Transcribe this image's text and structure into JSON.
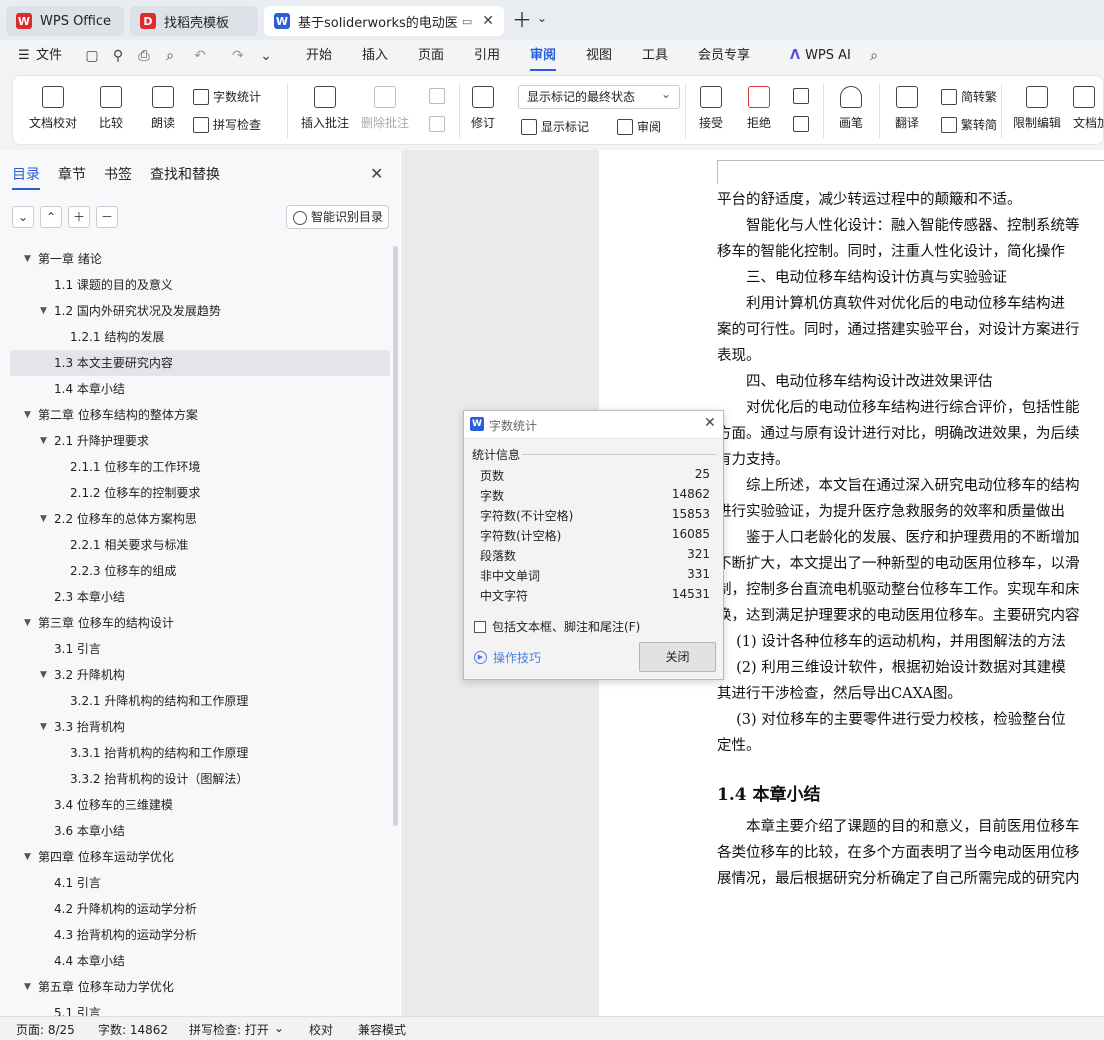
{
  "tabs": [
    {
      "label": "WPS Office",
      "logo": "W",
      "color": "#e02a2a"
    },
    {
      "label": "找稻壳模板",
      "logo": "D",
      "color": "#e02a2a"
    },
    {
      "label": "基于soliderworks的电动医用",
      "logo": "W",
      "color": "#2b5fd9"
    }
  ],
  "menu": {
    "file": "文件",
    "items": [
      "开始",
      "插入",
      "页面",
      "引用",
      "审阅",
      "视图",
      "工具",
      "会员专享"
    ],
    "active": "审阅",
    "wps_ai": "WPS AI"
  },
  "ribbon": {
    "doc_check": "文档校对",
    "compare": "比较",
    "read_aloud": "朗读",
    "word_count": "字数统计",
    "spell_check": "拼写检查",
    "insert_comment": "插入批注",
    "delete_comment": "删除批注",
    "revise": "修订",
    "markup_select": "显示标记的最终状态",
    "show_markup": "显示标记",
    "review_pane": "审阅",
    "accept": "接受",
    "reject": "拒绝",
    "pen": "画笔",
    "translate": "翻译",
    "to_traditional": "简转繁",
    "to_simplified": "繁转简",
    "restrict_edit": "限制编辑",
    "doc_protect": "文档加"
  },
  "nav": {
    "tabs": [
      "目录",
      "章节",
      "书签",
      "查找和替换"
    ],
    "smart_toc": "智能识别目录",
    "toc": [
      {
        "label": "第一章  绪论",
        "level": 0,
        "exp": true
      },
      {
        "label": "1.1  课题的目的及意义",
        "level": 1
      },
      {
        "label": "1.2  国内外研究状况及发展趋势",
        "level": 1,
        "exp": true
      },
      {
        "label": "1.2.1  结构的发展",
        "level": 2
      },
      {
        "label": "1.3  本文主要研究内容",
        "level": 1,
        "selected": true
      },
      {
        "label": "1.4  本章小结",
        "level": 1
      },
      {
        "label": "第二章  位移车结构的整体方案",
        "level": 0,
        "exp": true
      },
      {
        "label": "2.1  升降护理要求",
        "level": 1,
        "exp": true
      },
      {
        "label": "2.1.1  位移车的工作环境",
        "level": 2
      },
      {
        "label": "2.1.2  位移车的控制要求",
        "level": 2
      },
      {
        "label": "2.2  位移车的总体方案构思",
        "level": 1,
        "exp": true
      },
      {
        "label": "2.2.1  相关要求与标准",
        "level": 2
      },
      {
        "label": "2.2.3  位移车的组成",
        "level": 2
      },
      {
        "label": "2.3  本章小结",
        "level": 1
      },
      {
        "label": "第三章  位移车的结构设计",
        "level": 0,
        "exp": true
      },
      {
        "label": "3.1  引言",
        "level": 1
      },
      {
        "label": "3.2  升降机构",
        "level": 1,
        "exp": true
      },
      {
        "label": "3.2.1  升降机构的结构和工作原理",
        "level": 2
      },
      {
        "label": "3.3  抬背机构",
        "level": 1,
        "exp": true
      },
      {
        "label": "3.3.1  抬背机构的结构和工作原理",
        "level": 2
      },
      {
        "label": "3.3.2  抬背机构的设计（图解法）",
        "level": 2
      },
      {
        "label": "3.4 位移车的三维建模",
        "level": 1
      },
      {
        "label": "3.6  本章小结",
        "level": 1
      },
      {
        "label": "第四章  位移车运动学优化",
        "level": 0,
        "exp": true
      },
      {
        "label": "4.1  引言",
        "level": 1
      },
      {
        "label": "4.2 升降机构的运动学分析",
        "level": 1
      },
      {
        "label": "4.3 抬背机构的运动学分析",
        "level": 1
      },
      {
        "label": "4.4 本章小结",
        "level": 1
      },
      {
        "label": "第五章  位移车动力学优化",
        "level": 0,
        "exp": true
      },
      {
        "label": "5.1 引言",
        "level": 1
      }
    ]
  },
  "document": {
    "lines": [
      "平台的舒适度，减少转运过程中的颠簸和不适。",
      "　　智能化与人性化设计：融入智能传感器、控制系统等",
      "移车的智能化控制。同时，注重人性化设计，简化操作",
      "　　三、电动位移车结构设计仿真与实验验证",
      "　　利用计算机仿真软件对优化后的电动位移车结构进",
      "案的可行性。同时，通过搭建实验平台，对设计方案进行",
      "表现。",
      "　　四、电动位移车结构设计改进效果评估",
      "　　对优化后的电动位移车结构进行综合评价，包括性能",
      "方面。通过与原有设计进行对比，明确改进效果，为后续",
      "有力支持。",
      "　　综上所述，本文旨在通过深入研究电动位移车的结构",
      "进行实验验证，为提升医疗急救服务的效率和质量做出",
      "　　鉴于人口老龄化的发展、医疗和护理费用的不断增加",
      "不断扩大，本文提出了一种新型的电动医用位移车，以滑",
      "制，控制多台直流电机驱动整台位移车工作。实现车和床",
      "换，达到满足护理要求的电动医用位移车。主要研究内容",
      "　 (1)  设计各种位移车的运动机构，并用图解法的方法",
      "　 (2)  利用三维设计软件，根据初始设计数据对其建模",
      "其进行干涉检查，然后导出CAXA图。",
      "　 (3)  对位移车的主要零件进行受力校核，检验整台位",
      "定性。"
    ],
    "heading": "1.4  本章小结",
    "lines2": [
      "　　本章主要介绍了课题的目的和意义，目前医用位移车",
      "各类位移车的比较，在多个方面表明了当今电动医用位移",
      "展情况，最后根据研究分析确定了自己所需完成的研究内"
    ]
  },
  "dialog": {
    "title": "字数统计",
    "group": "统计信息",
    "stats": [
      {
        "label": "页数",
        "value": "25"
      },
      {
        "label": "字数",
        "value": "14862"
      },
      {
        "label": "字符数(不计空格)",
        "value": "15853"
      },
      {
        "label": "字符数(计空格)",
        "value": "16085"
      },
      {
        "label": "段落数",
        "value": "321"
      },
      {
        "label": "非中文单词",
        "value": "331"
      },
      {
        "label": "中文字符",
        "value": "14531"
      }
    ],
    "include_label": "包括文本框、脚注和尾注(F)",
    "tips": "操作技巧",
    "close": "关闭"
  },
  "status": {
    "page": "页面: 8/25",
    "words": "字数: 14862",
    "spell": "拼写检查: 打开",
    "proof": "校对",
    "compat": "兼容模式"
  }
}
